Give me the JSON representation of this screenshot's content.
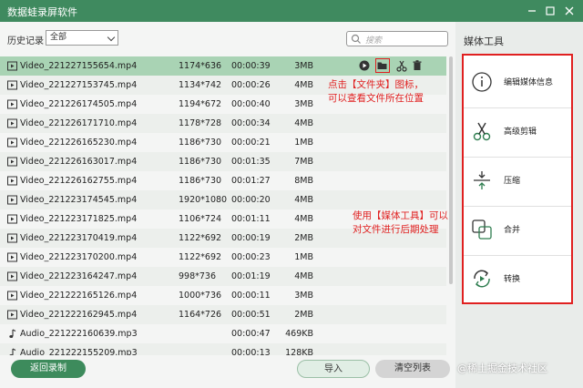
{
  "window": {
    "title": "数据蛙录屏软件"
  },
  "filter": {
    "history_label": "历史记录",
    "select_value": "全部",
    "search_placeholder": "搜索"
  },
  "files": [
    {
      "type": "video",
      "name": "Video_221227155654.mp4",
      "resolution": "1174*636",
      "duration": "00:00:39",
      "size": "3MB",
      "selected": true
    },
    {
      "type": "video",
      "name": "Video_221227153745.mp4",
      "resolution": "1134*742",
      "duration": "00:00:26",
      "size": "4MB"
    },
    {
      "type": "video",
      "name": "Video_221226174505.mp4",
      "resolution": "1194*672",
      "duration": "00:00:40",
      "size": "3MB"
    },
    {
      "type": "video",
      "name": "Video_221226171710.mp4",
      "resolution": "1178*728",
      "duration": "00:00:34",
      "size": "4MB"
    },
    {
      "type": "video",
      "name": "Video_221226165230.mp4",
      "resolution": "1186*730",
      "duration": "00:00:21",
      "size": "1MB"
    },
    {
      "type": "video",
      "name": "Video_221226163017.mp4",
      "resolution": "1186*730",
      "duration": "00:01:35",
      "size": "7MB"
    },
    {
      "type": "video",
      "name": "Video_221226162755.mp4",
      "resolution": "1186*730",
      "duration": "00:01:27",
      "size": "8MB"
    },
    {
      "type": "video",
      "name": "Video_221223174545.mp4",
      "resolution": "1920*1080",
      "duration": "00:00:20",
      "size": "4MB"
    },
    {
      "type": "video",
      "name": "Video_221223171825.mp4",
      "resolution": "1106*724",
      "duration": "00:01:11",
      "size": "4MB"
    },
    {
      "type": "video",
      "name": "Video_221223170419.mp4",
      "resolution": "1122*692",
      "duration": "00:00:19",
      "size": "2MB"
    },
    {
      "type": "video",
      "name": "Video_221223170200.mp4",
      "resolution": "1122*692",
      "duration": "00:00:23",
      "size": "1MB"
    },
    {
      "type": "video",
      "name": "Video_221223164247.mp4",
      "resolution": "998*736",
      "duration": "00:01:19",
      "size": "4MB"
    },
    {
      "type": "video",
      "name": "Video_221222165126.mp4",
      "resolution": "1000*736",
      "duration": "00:00:11",
      "size": "3MB"
    },
    {
      "type": "video",
      "name": "Video_221222162945.mp4",
      "resolution": "1164*726",
      "duration": "00:00:51",
      "size": "2MB"
    },
    {
      "type": "audio",
      "name": "Audio_221222160639.mp3",
      "resolution": "",
      "duration": "00:00:47",
      "size": "469KB"
    },
    {
      "type": "audio",
      "name": "Audio_221222155209.mp3",
      "resolution": "",
      "duration": "00:00:13",
      "size": "128KB"
    }
  ],
  "annotations": {
    "folder_note_line1": "点击【文件夹】图标，",
    "folder_note_line2": "可以查看文件所在位置",
    "tools_note_line1": "使用【媒体工具】可以",
    "tools_note_line2": "对文件进行后期处理"
  },
  "sidebar": {
    "title": "媒体工具",
    "tools": [
      {
        "label": "编辑媒体信息",
        "icon": "info-icon"
      },
      {
        "label": "高级剪辑",
        "icon": "scissors-icon"
      },
      {
        "label": "压缩",
        "icon": "compress-icon"
      },
      {
        "label": "合并",
        "icon": "merge-icon"
      },
      {
        "label": "转换",
        "icon": "convert-icon"
      }
    ]
  },
  "footer": {
    "back_label": "返回录制",
    "import_label": "导入",
    "clear_label": "清空列表"
  },
  "watermark": "@稀土掘金技术社区",
  "colors": {
    "titlebar": "#3f8a5f",
    "selected_row": "#a9d3b4",
    "accent_red": "#e02020",
    "primary_button": "#3d8b5c"
  }
}
